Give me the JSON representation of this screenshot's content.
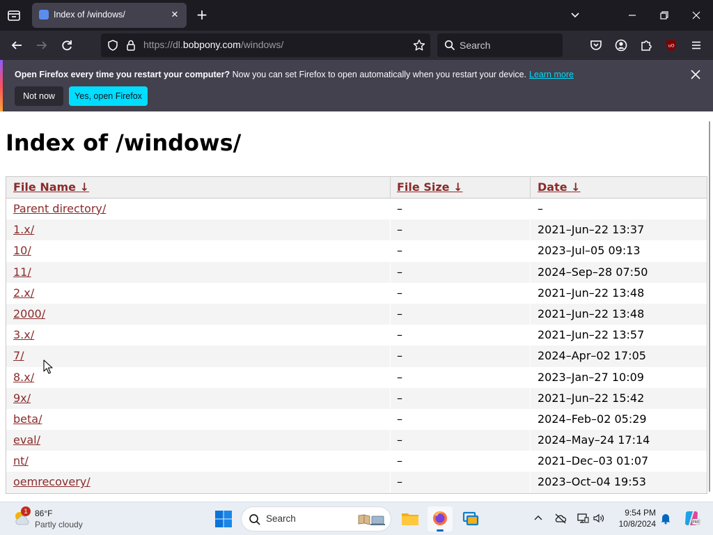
{
  "tab": {
    "title": "Index of /windows/",
    "favicon": "page-icon"
  },
  "url": {
    "prefix": "https://dl.",
    "host": "bobpony.com",
    "path": "/windows/"
  },
  "searchbar": {
    "placeholder": "Search"
  },
  "notification": {
    "bold": "Open Firefox every time you restart your computer?",
    "text": " Now you can set Firefox to open automatically when you restart your device.",
    "link": "Learn more",
    "not_now": "Not now",
    "yes": "Yes, open Firefox"
  },
  "page": {
    "title": "Index of /windows/",
    "columns": {
      "name": "File Name",
      "size": "File Size",
      "date": "Date",
      "sort_arrow": "↓"
    },
    "rows": [
      {
        "name": "Parent directory/",
        "size": "–",
        "date": "–"
      },
      {
        "name": "1.x/",
        "size": "–",
        "date": "2021–Jun–22 13:37"
      },
      {
        "name": "10/",
        "size": "–",
        "date": "2023–Jul–05 09:13"
      },
      {
        "name": "11/",
        "size": "–",
        "date": "2024–Sep–28 07:50"
      },
      {
        "name": "2.x/",
        "size": "–",
        "date": "2021–Jun–22 13:48"
      },
      {
        "name": "2000/",
        "size": "–",
        "date": "2021–Jun–22 13:48"
      },
      {
        "name": "3.x/",
        "size": "–",
        "date": "2021–Jun–22 13:57"
      },
      {
        "name": "7/",
        "size": "–",
        "date": "2024–Apr–02 17:05"
      },
      {
        "name": "8.x/",
        "size": "–",
        "date": "2023–Jan–27 10:09"
      },
      {
        "name": "9x/",
        "size": "–",
        "date": "2021–Jun–22 15:42"
      },
      {
        "name": "beta/",
        "size": "–",
        "date": "2024–Feb–02 05:29"
      },
      {
        "name": "eval/",
        "size": "–",
        "date": "2024–May–24 17:14"
      },
      {
        "name": "nt/",
        "size": "–",
        "date": "2021–Dec–03 01:07"
      },
      {
        "name": "oemrecovery/",
        "size": "–",
        "date": "2023–Oct–04 19:53"
      }
    ]
  },
  "taskbar": {
    "weather_temp": "86°F",
    "weather_desc": "Partly cloudy",
    "weather_badge": "1",
    "search_placeholder": "Search",
    "time": "9:54 PM",
    "date": "10/8/2024"
  },
  "colors": {
    "link": "#8b2b2b",
    "accent_cyan": "#00ddff",
    "chrome_dark": "#1c1b22",
    "taskbar_accent": "#0067c0"
  }
}
